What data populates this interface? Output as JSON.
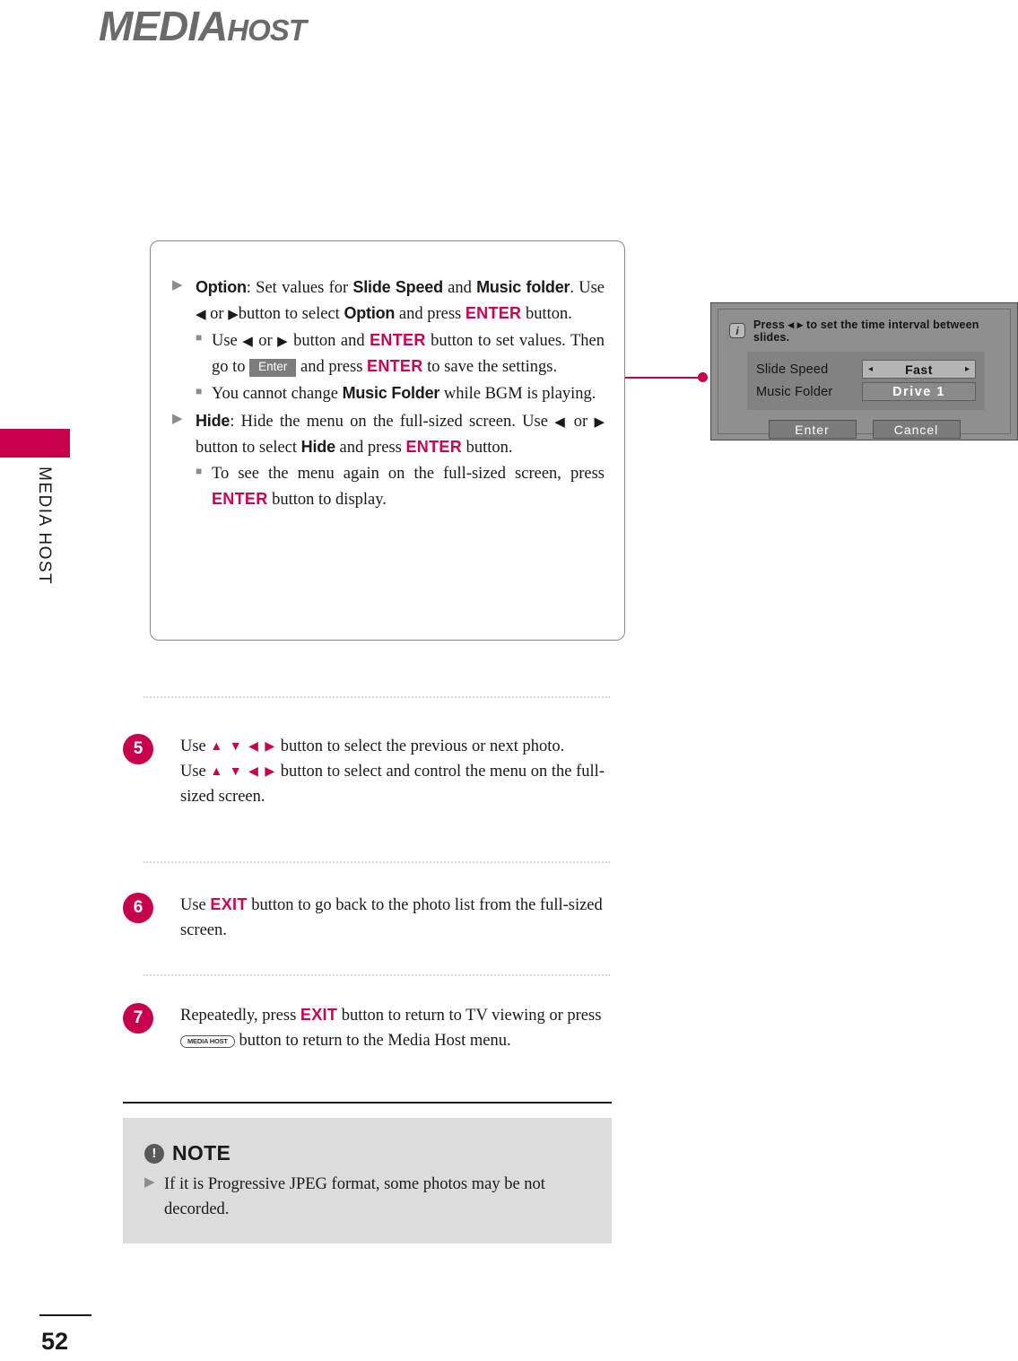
{
  "header": {
    "logo_primary": "MEDIA",
    "logo_secondary": "HOST"
  },
  "sidebar": {
    "tab_label": "MEDIA HOST"
  },
  "info_box": {
    "option": {
      "term": "Option",
      "text_1": ": Set values for ",
      "kw_slide_speed": "Slide Speed",
      "text_2": " and ",
      "kw_music_folder": "Music folder",
      "text_3": ". Use ",
      "arrow_left": "◀",
      "text_4": " or ",
      "arrow_right": "▶",
      "text_5": "button to select ",
      "kw_option": "Option",
      "text_6": " and press ",
      "key_enter": "ENTER",
      "text_7": " button.",
      "sub_1": {
        "text_1": "Use ",
        "arrow_left": "◀",
        "text_2": " or ",
        "arrow_right": "▶",
        "text_3": " button and ",
        "key_enter_1": "ENTER",
        "text_4": " button to set values. Then go to ",
        "badge_enter": "Enter",
        "text_5": " and press ",
        "key_enter_2": "ENTER",
        "text_6": " to save the settings."
      },
      "sub_2": {
        "text_1": "You cannot change ",
        "kw_music_folder": "Music Folder",
        "text_2": " while BGM is playing."
      }
    },
    "hide": {
      "term": "Hide",
      "text_1": ": Hide the menu on the full-sized screen. Use ",
      "arrow_left": "◀",
      "text_2": " or ",
      "arrow_right": "▶",
      "text_3": " button to select ",
      "kw_hide": "Hide",
      "text_4": " and press ",
      "key_enter": "ENTER",
      "text_5": " button.",
      "sub_1": {
        "text_1": "To see the menu again on the full-sized screen, press ",
        "key_enter": "ENTER",
        "text_2": " button to display."
      }
    }
  },
  "osd": {
    "info_icon_glyph": "i",
    "hint": "Press ◂ ▸ to set the time interval between slides.",
    "rows": [
      {
        "label": "Slide Speed",
        "value": "Fast",
        "selected": true,
        "caret_left": "◂",
        "caret_right": "▸"
      },
      {
        "label": "Music Folder",
        "value": "Drive 1",
        "selected": false,
        "caret_left": "",
        "caret_right": ""
      }
    ],
    "buttons": [
      {
        "label": "Enter"
      },
      {
        "label": "Cancel"
      }
    ]
  },
  "steps": [
    {
      "number": "5",
      "line_1_pre": "Use ",
      "dpad": "▲ ▼ ◀ ▶",
      "line_1_post": " button to select the previous or next photo.",
      "line_2_pre": "Use ",
      "line_2_post": " button to select and control the menu on the full-sized screen."
    },
    {
      "number": "6",
      "text_1": "Use ",
      "key_exit": "EXIT",
      "text_2": " button to go back to the photo list from the full-sized screen."
    },
    {
      "number": "7",
      "text_1": "Repeatedly, press ",
      "key_exit": "EXIT",
      "text_2": " button to return to TV viewing or press ",
      "mh_button": "MEDIA HOST",
      "text_3": " button to return to the Media Host menu."
    }
  ],
  "note": {
    "icon_glyph": "!",
    "title": "NOTE",
    "bullet": "▶",
    "text": "If it is Progressive JPEG format, some photos may be not decorded."
  },
  "footer": {
    "page_number": "52"
  },
  "colors": {
    "accent": "#c8004b",
    "keyword_red": "#cc0052",
    "note_bg": "#dcdcdc",
    "osd_bg": "#8f8f8f",
    "logo_gray": "#6a6a6a"
  }
}
